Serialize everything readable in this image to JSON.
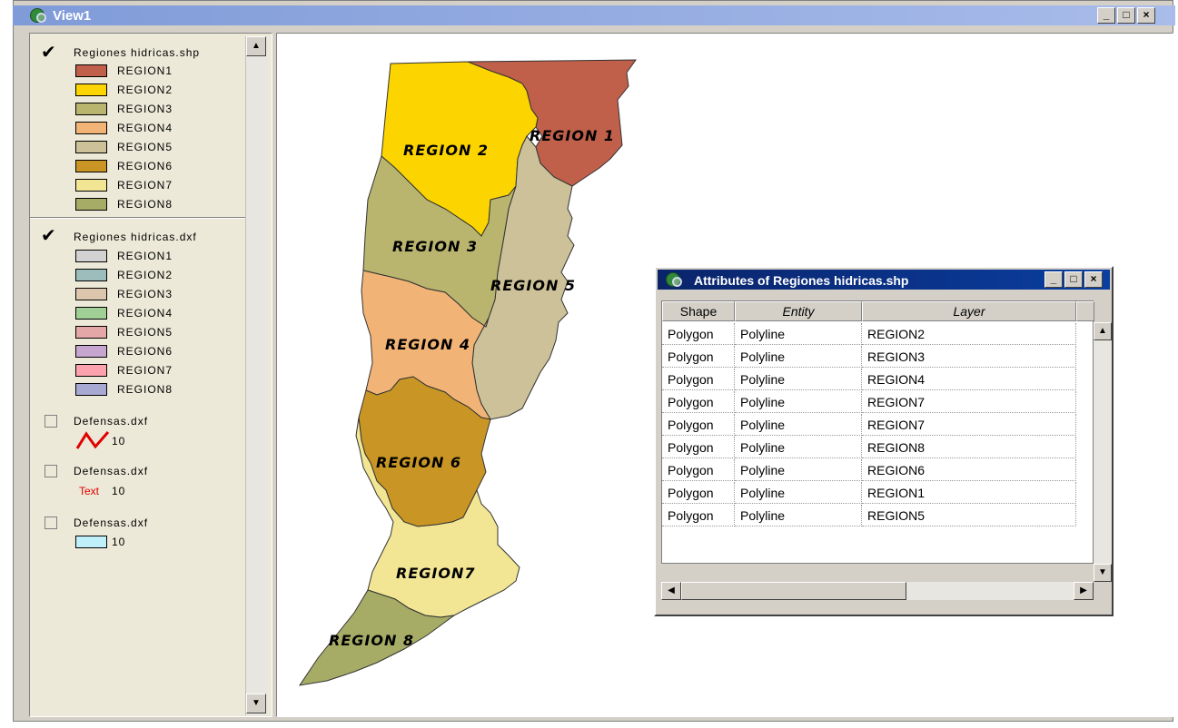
{
  "window": {
    "title": "View1",
    "minimize": "_",
    "maximize": "□",
    "close": "×"
  },
  "legend": {
    "layers": [
      {
        "name": "Regiones hidricas.shp",
        "checked": true,
        "classes": [
          {
            "label": "REGION1",
            "color": "#c0604a"
          },
          {
            "label": "REGION2",
            "color": "#fcd400"
          },
          {
            "label": "REGION3",
            "color": "#b9b46e"
          },
          {
            "label": "REGION4",
            "color": "#f2b476"
          },
          {
            "label": "REGION5",
            "color": "#ccc198"
          },
          {
            "label": "REGION6",
            "color": "#c99625"
          },
          {
            "label": "REGION7",
            "color": "#f2e694"
          },
          {
            "label": "REGION8",
            "color": "#a6ac66"
          }
        ]
      },
      {
        "name": "Regiones hidricas.dxf",
        "checked": true,
        "classes": [
          {
            "label": "REGION1",
            "color": "#d2d2d2"
          },
          {
            "label": "REGION2",
            "color": "#9dbdbd"
          },
          {
            "label": "REGION3",
            "color": "#dcc6ae"
          },
          {
            "label": "REGION4",
            "color": "#a0d096"
          },
          {
            "label": "REGION5",
            "color": "#e4a7a7"
          },
          {
            "label": "REGION6",
            "color": "#c6a6cf"
          },
          {
            "label": "REGION7",
            "color": "#fca2ae"
          },
          {
            "label": "REGION8",
            "color": "#a7a9d2"
          }
        ]
      },
      {
        "name": "Defensas.dxf",
        "checked": false,
        "symbol": "line",
        "symbol_color": "#e00000",
        "value": "10"
      },
      {
        "name": "Defensas.dxf",
        "checked": false,
        "symbol": "text",
        "symbol_text": "Text",
        "value": "10"
      },
      {
        "name": "Defensas.dxf",
        "checked": false,
        "symbol": "fill",
        "symbol_color": "#bff0fa",
        "value": "10"
      }
    ]
  },
  "map": {
    "labels": [
      "REGION 1",
      "REGION 2",
      "REGION 3",
      "REGION 4",
      "REGION 5",
      "REGION 6",
      "REGION7",
      "REGION 8"
    ]
  },
  "attributes": {
    "title": "Attributes of Regiones hidricas.shp",
    "columns": [
      "Shape",
      "Entity",
      "Layer"
    ],
    "rows": [
      [
        "Polygon",
        "Polyline",
        "REGION2"
      ],
      [
        "Polygon",
        "Polyline",
        "REGION3"
      ],
      [
        "Polygon",
        "Polyline",
        "REGION4"
      ],
      [
        "Polygon",
        "Polyline",
        "REGION7"
      ],
      [
        "Polygon",
        "Polyline",
        "REGION7"
      ],
      [
        "Polygon",
        "Polyline",
        "REGION8"
      ],
      [
        "Polygon",
        "Polyline",
        "REGION6"
      ],
      [
        "Polygon",
        "Polyline",
        "REGION1"
      ],
      [
        "Polygon",
        "Polyline",
        "REGION5"
      ]
    ]
  }
}
